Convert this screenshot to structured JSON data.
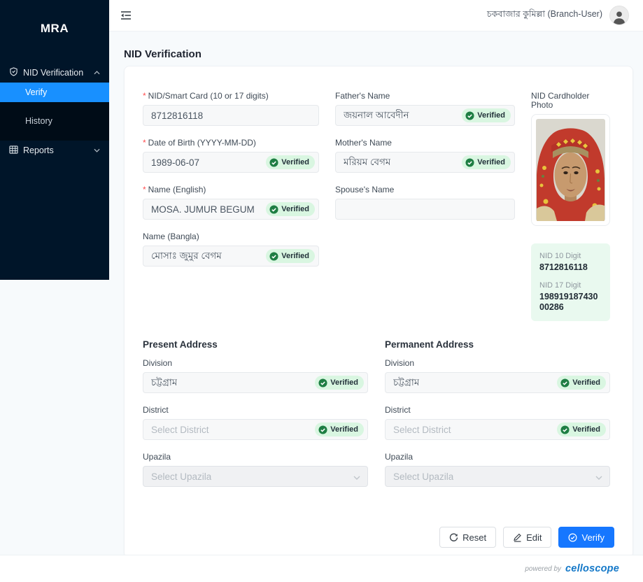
{
  "sidebar": {
    "brand": "MRA",
    "nid_verification": "NID Verification",
    "verify": "Verify",
    "history": "History",
    "reports": "Reports"
  },
  "header": {
    "user": "চকবাজার কুমিল্লা (Branch-User)"
  },
  "page": {
    "title": "NID Verification"
  },
  "form": {
    "required_mark": "*",
    "nid": {
      "label": "NID/Smart Card (10 or 17 digits)",
      "value": "8712816118"
    },
    "dob": {
      "label": "Date of Birth (YYYY-MM-DD)",
      "value": "1989-06-07",
      "badge": "Verified"
    },
    "name_en": {
      "label": "Name (English)",
      "value": "MOSA. JUMUR BEGUM",
      "badge": "Verified"
    },
    "name_bn": {
      "label": "Name (Bangla)",
      "value": "মোসাঃ জুমুর বেগম",
      "badge": "Verified"
    },
    "father": {
      "label": "Father's Name",
      "value": "জয়নাল আবেদীন",
      "badge": "Verified"
    },
    "mother": {
      "label": "Mother's Name",
      "value": "মরিয়ম বেগম",
      "badge": "Verified"
    },
    "spouse": {
      "label": "Spouse's Name",
      "value": ""
    }
  },
  "photo": {
    "label": "NID Cardholder Photo"
  },
  "nid_summary": {
    "nid10_label": "NID 10 Digit",
    "nid10": "8712816118",
    "nid17_label": "NID 17 Digit",
    "nid17": "19891918743000286"
  },
  "address": {
    "present": {
      "title": "Present Address",
      "division_label": "Division",
      "division": "চট্টগ্রাম",
      "division_badge": "Verified",
      "district_label": "District",
      "district_placeholder": "Select District",
      "district_badge": "Verified",
      "upazila_label": "Upazila",
      "upazila_placeholder": "Select Upazila"
    },
    "permanent": {
      "title": "Permanent Address",
      "division_label": "Division",
      "division": "চট্টগ্রাম",
      "division_badge": "Verified",
      "district_label": "District",
      "district_placeholder": "Select District",
      "district_badge": "Verified",
      "upazila_label": "Upazila",
      "upazila_placeholder": "Select Upazila"
    }
  },
  "actions": {
    "reset": "Reset",
    "edit": "Edit",
    "verify": "Verify"
  },
  "footer": {
    "powered_by": "powered by",
    "brand": "celloscope"
  },
  "colors": {
    "sidebar_bg": "#001529",
    "submenu_bg": "#000c17",
    "active_item": "#1890ff",
    "verify_button": "#1677ff",
    "verified_badge_bg": "#d9f6e1",
    "verified_check": "#1e7e43",
    "nid_box_bg": "#e9f9ef",
    "footer_brand": "#1478c8",
    "required": "#ff4d4f"
  }
}
